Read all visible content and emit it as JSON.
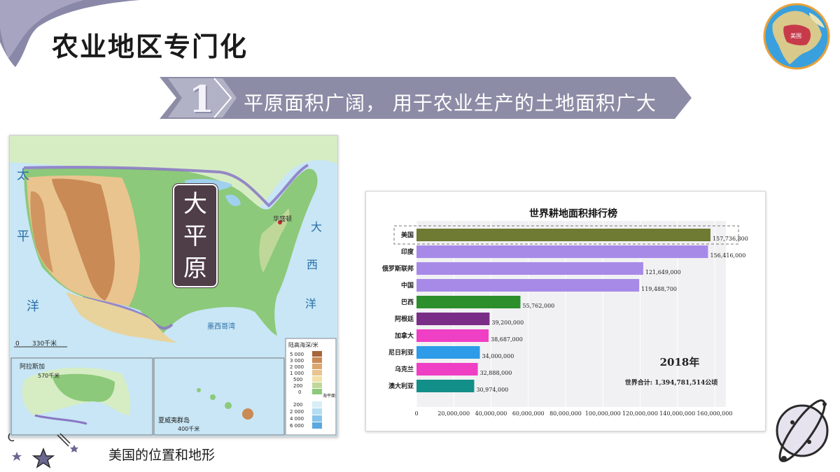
{
  "slide": {
    "title": "农业地区专门化",
    "banner_number": "1",
    "banner_text": "平原面积广阔， 用于农业生产的土地面积广大"
  },
  "globe": {
    "label": "美国"
  },
  "map": {
    "plain_label": "大平原",
    "caption": "美国的位置和地形",
    "ocean_labels": [
      "太",
      "平",
      "洋",
      "大",
      "西",
      "洋"
    ],
    "city_label": "华盛顿",
    "sea_label": "墨西哥湾",
    "scale_main": "330千米",
    "scale_alaska": "570千米",
    "scale_hawaii": "400千米",
    "inset_alaska_title": "阿拉斯加",
    "inset_hawaii_title": "夏威夷群岛",
    "legend_title": "陆高海深/米",
    "legend_land": [
      "5 000",
      "3 000",
      "2 000",
      "1 000",
      "500",
      "200",
      "0"
    ],
    "legend_sea": [
      "200",
      "2 000",
      "4 000",
      "6 000"
    ],
    "legend_sea_level": "海平面",
    "colors": {
      "sea": "#c8e6f5",
      "lowland": "#8cc97a",
      "upland": "#e9c48f",
      "mountain": "#c98a55",
      "border": "#8a76c4"
    }
  },
  "chart_data": {
    "type": "bar",
    "orientation": "horizontal",
    "title": "世界耕地面积排行榜",
    "categories": [
      "美国",
      "印度",
      "俄罗斯联邦",
      "中国",
      "巴西",
      "阿根廷",
      "加拿大",
      "尼日利亚",
      "乌克兰",
      "澳大利亚"
    ],
    "values": [
      157736800,
      156416000,
      121649000,
      119488700,
      55762000,
      39200000,
      38687000,
      34000000,
      32888000,
      30974000
    ],
    "value_labels": [
      "157,736,800",
      "156,416,000",
      "121,649,000",
      "119,488,700",
      "55,762,000",
      "39,200,000",
      "38,687,000",
      "34,000,000",
      "32,888,000",
      "30,974,000"
    ],
    "bar_colors": [
      "#6f7a33",
      "#a78ae8",
      "#a78ae8",
      "#a78ae8",
      "#2c8f2c",
      "#7a2d86",
      "#ef3fc4",
      "#2d9be8",
      "#ef3fc4",
      "#138f89"
    ],
    "xlim": [
      0,
      160000000
    ],
    "xticks": [
      0,
      20000000,
      40000000,
      60000000,
      80000000,
      100000000,
      120000000,
      140000000,
      160000000
    ],
    "xtick_labels": [
      "0",
      "20,000,000",
      "40,000,000",
      "60,000,000",
      "80,000,000",
      "100,000,000",
      "120,000,000",
      "140,000,000",
      "160,000,000"
    ],
    "year": "2018年",
    "total_label": "世界合计: 1,394,781,514公顷",
    "highlight": "美国",
    "grid": true
  }
}
